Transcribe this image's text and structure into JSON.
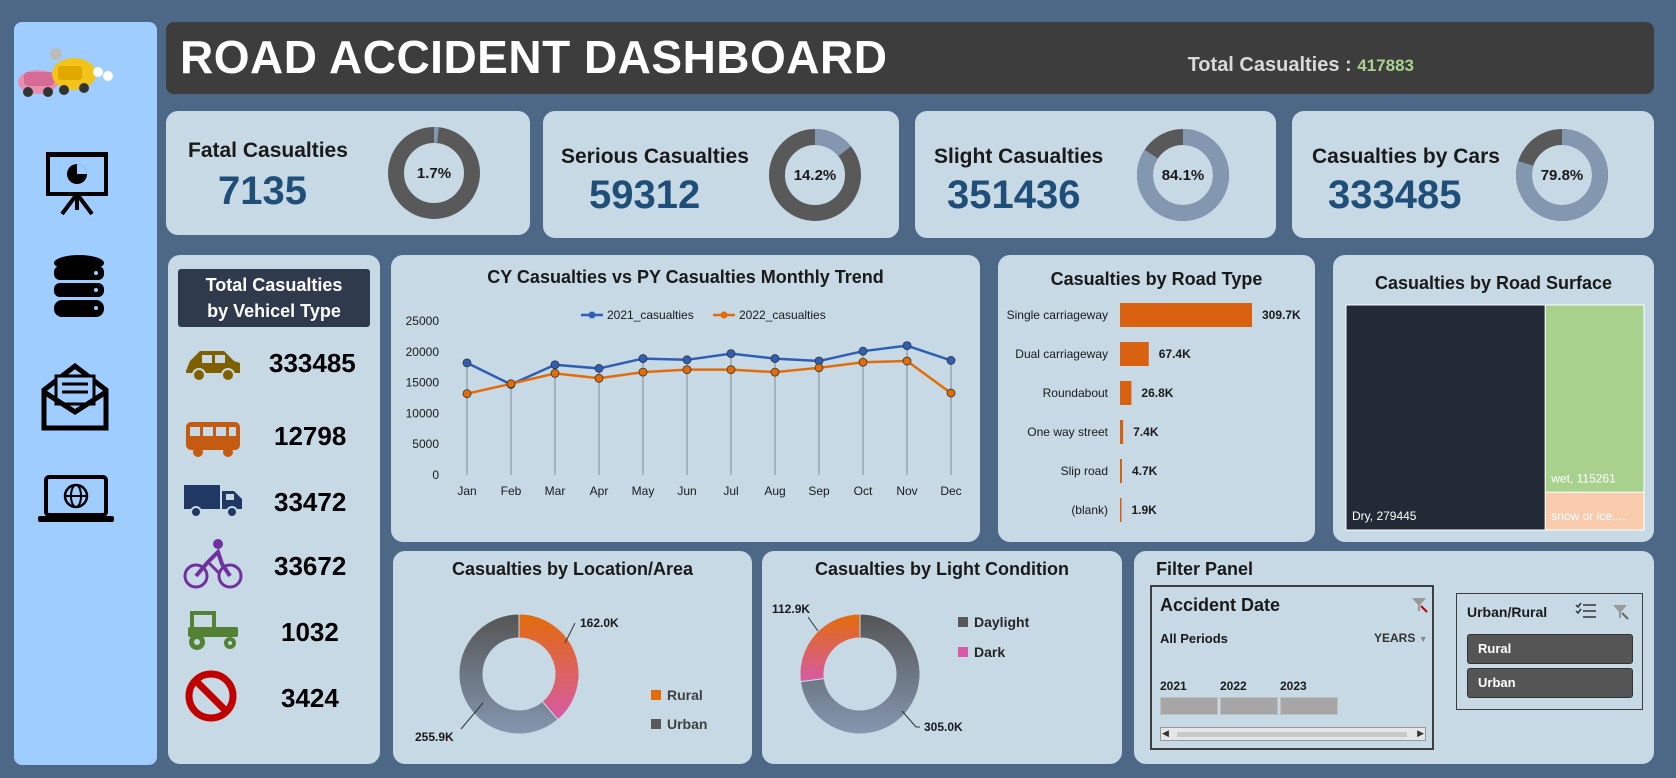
{
  "header": {
    "title": "ROAD ACCIDENT DASHBOARD",
    "total_label": "Total Casualties :",
    "total_value": "417883"
  },
  "sidebar": {
    "icons": [
      "car-crash-logo",
      "presentation-icon",
      "database-icon",
      "mail-icon",
      "laptop-icon"
    ]
  },
  "kpis": [
    {
      "label": "Fatal Casualties",
      "value": "7135",
      "pct": "1.7%",
      "fraction": 0.017
    },
    {
      "label": "Serious Casualties",
      "value": "59312",
      "pct": "14.2%",
      "fraction": 0.142
    },
    {
      "label": "Slight Casualties",
      "value": "351436",
      "pct": "84.1%",
      "fraction": 0.841
    },
    {
      "label": "Casualties by Cars",
      "value": "333485",
      "pct": "79.8%",
      "fraction": 0.798
    }
  ],
  "vehicles": {
    "title_line1": "Total Casualties",
    "title_line2": "by Vehicel Type",
    "items": [
      {
        "icon": "car-icon",
        "value": "333485",
        "color": "#7f6000"
      },
      {
        "icon": "bus-icon",
        "value": "12798",
        "color": "#c55a11"
      },
      {
        "icon": "truck-icon",
        "value": "33472",
        "color": "#1f3864"
      },
      {
        "icon": "bicycle-icon",
        "value": "33672",
        "color": "#7030a0"
      },
      {
        "icon": "tractor-icon",
        "value": "1032",
        "color": "#548235"
      },
      {
        "icon": "no-entry-icon",
        "value": "3424",
        "color": "#c00000"
      }
    ]
  },
  "trend": {
    "title": "CY Casualties vs PY Casualties Monthly Trend",
    "chart_data": {
      "type": "line",
      "categories": [
        "Jan",
        "Feb",
        "Mar",
        "Apr",
        "May",
        "Jun",
        "Jul",
        "Aug",
        "Sep",
        "Oct",
        "Nov",
        "Dec"
      ],
      "series": [
        {
          "name": "2021_casualties",
          "color": "#2e5fb5",
          "values": [
            18200,
            14700,
            17900,
            17300,
            18900,
            18700,
            19700,
            18900,
            18500,
            20100,
            21000,
            18600
          ]
        },
        {
          "name": "2022_casualties",
          "color": "#e36c09",
          "values": [
            13200,
            14800,
            16500,
            15700,
            16700,
            17100,
            17100,
            16700,
            17400,
            18300,
            18500,
            13300
          ]
        }
      ],
      "yticks": [
        "25000",
        "20000",
        "15000",
        "10000",
        "5000",
        "0"
      ],
      "ylim": [
        0,
        25000
      ]
    }
  },
  "road_type": {
    "title": "Casualties by Road Type",
    "chart_data": {
      "type": "bar",
      "categories": [
        "Single carriageway",
        "Dual carriageway",
        "Roundabout",
        "One way street",
        "Slip road",
        "(blank)"
      ],
      "values": [
        309.7,
        67.4,
        26.8,
        7.4,
        4.7,
        1.9
      ],
      "labels": [
        "309.7K",
        "67.4K",
        "26.8K",
        "7.4K",
        "4.7K",
        "1.9K"
      ]
    }
  },
  "road_surface": {
    "title": "Casualties by Road Surface",
    "chart_data": {
      "type": "treemap",
      "items": [
        {
          "label": "Dry, 279445",
          "value": 279445,
          "color": "#222a35"
        },
        {
          "label": "wet, 115261",
          "value": 115261,
          "color": "#a9d18e"
        },
        {
          "label": "snow or ice,...",
          "value": 23177,
          "color": "#f8cbad"
        }
      ]
    }
  },
  "location": {
    "title": "Casualties by Location/Area",
    "chart_data": {
      "type": "pie",
      "items": [
        {
          "name": "Rural",
          "value": 162.0,
          "label": "162.0K"
        },
        {
          "name": "Urban",
          "value": 255.9,
          "label": "255.9K"
        }
      ]
    },
    "legend": [
      "Rural",
      "Urban"
    ]
  },
  "light": {
    "title": "Casualties by Light Condition",
    "chart_data": {
      "type": "pie",
      "items": [
        {
          "name": "Daylight",
          "value": 305.0,
          "label": "305.0K"
        },
        {
          "name": "Dark",
          "value": 112.9,
          "label": "112.9K"
        }
      ]
    },
    "legend": [
      "Daylight",
      "Dark"
    ]
  },
  "filter": {
    "title": "Filter Panel",
    "date_slicer": {
      "title": "Accident Date",
      "period": "All Periods",
      "level": "YEARS",
      "years": [
        "2021",
        "2022",
        "2023"
      ]
    },
    "urban_slicer": {
      "title": "Urban/Rural",
      "options": [
        "Rural",
        "Urban"
      ]
    }
  }
}
